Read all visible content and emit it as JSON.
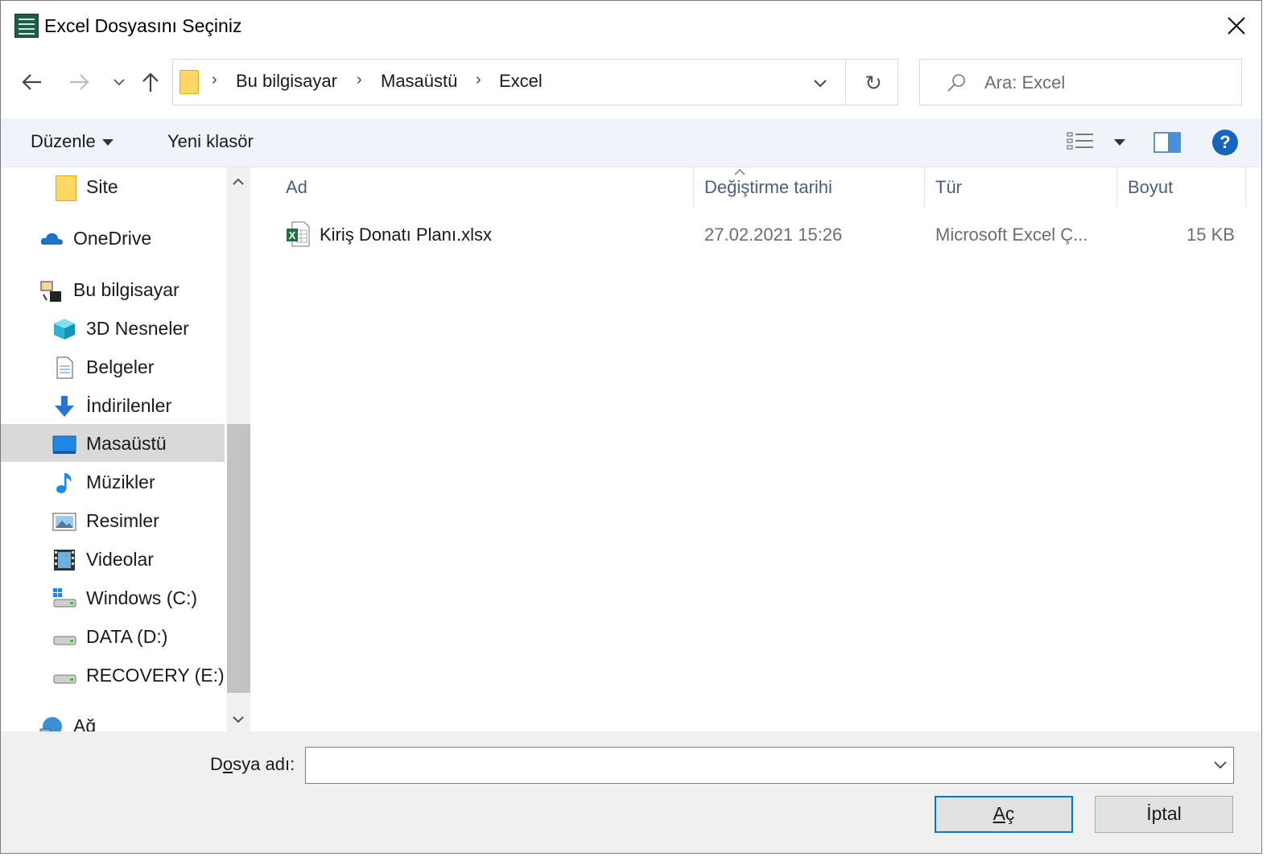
{
  "window": {
    "title": "Excel Dosyasını Seçiniz"
  },
  "address": {
    "crumbs": [
      "Bu bilgisayar",
      "Masaüstü",
      "Excel"
    ]
  },
  "search": {
    "placeholder": "Ara: Excel"
  },
  "commandbar": {
    "organize": "Düzenle",
    "new_folder": "Yeni klasör",
    "help": "?"
  },
  "nav": {
    "items": [
      {
        "label": "Site",
        "icon": "folder-icon"
      },
      {
        "label": "OneDrive",
        "icon": "cloud-icon"
      },
      {
        "label": "Bu bilgisayar",
        "icon": "computer-icon"
      },
      {
        "label": "3D Nesneler",
        "icon": "cube-icon"
      },
      {
        "label": "Belgeler",
        "icon": "document-icon"
      },
      {
        "label": "İndirilenler",
        "icon": "download-icon"
      },
      {
        "label": "Masaüstü",
        "icon": "desktop-icon",
        "selected": true
      },
      {
        "label": "Müzikler",
        "icon": "music-icon"
      },
      {
        "label": "Resimler",
        "icon": "pictures-icon"
      },
      {
        "label": "Videolar",
        "icon": "video-icon"
      },
      {
        "label": "Windows (C:)",
        "icon": "drive-icon"
      },
      {
        "label": "DATA (D:)",
        "icon": "drive-icon"
      },
      {
        "label": "RECOVERY (E:)",
        "icon": "drive-icon"
      },
      {
        "label": "Ağ",
        "icon": "network-icon"
      }
    ]
  },
  "filelist": {
    "columns": [
      "Ad",
      "Değiştirme tarihi",
      "Tür",
      "Boyut"
    ],
    "rows": [
      {
        "name": "Kiriş Donatı Planı.xlsx",
        "modified": "27.02.2021 15:26",
        "type": "Microsoft Excel Ç...",
        "size": "15 KB"
      }
    ]
  },
  "footer": {
    "filename_label_pre": "D",
    "filename_label_acc": "o",
    "filename_label_post": "sya adı:",
    "filename_value": "",
    "open_acc": "A",
    "open_rest": "ç",
    "cancel": "İptal"
  },
  "colors": {
    "accent": "#0078d7",
    "selection": "#d9d9d9",
    "commandbar_bg": "#f0f4f9",
    "header_text": "#4c607a"
  }
}
